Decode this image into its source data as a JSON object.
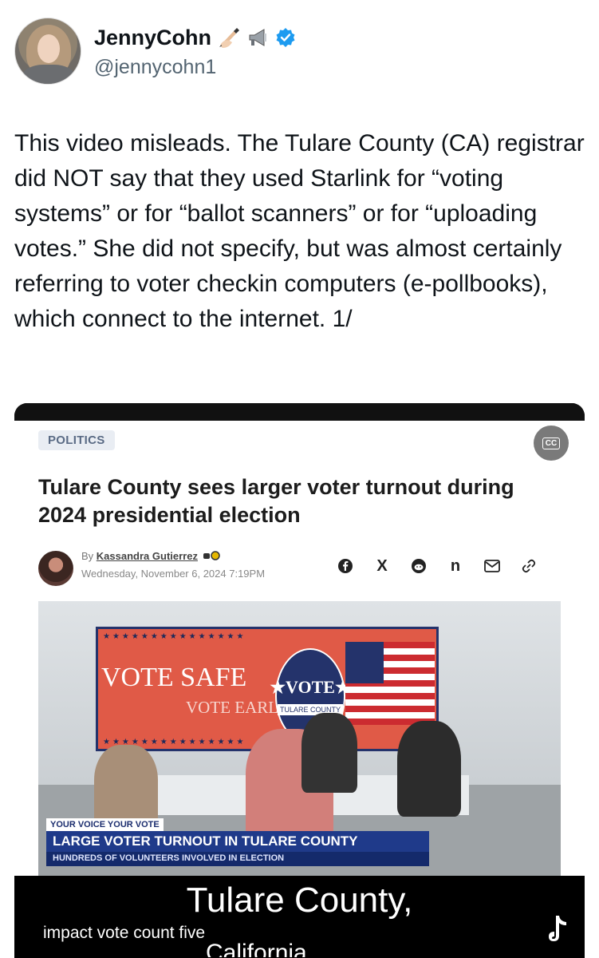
{
  "profile": {
    "display_name": "JennyCohn",
    "handle": "@jennycohn1",
    "badges": [
      "writing-hand-icon",
      "megaphone-icon",
      "verified-icon"
    ],
    "verified_color": "#1d9bf0"
  },
  "tweet": {
    "text": "This video misleads. The Tulare County (CA) registrar did NOT say that they used Starlink for “voting systems” or for “ballot scanners” or for “uploading votes.” She did not specify, but was almost certainly referring to voter checkin computers (e-pollbooks), which connect to the internet. 1/"
  },
  "media": {
    "article": {
      "category": "POLITICS",
      "cc_label": "CC",
      "headline": "Tulare County sees larger voter turnout during 2024 presidential election",
      "byline_prefix": "By",
      "author": "Kassandra Gutierrez",
      "date": "Wednesday, November 6, 2024 7:19PM",
      "share_icons": [
        "facebook-icon",
        "x-icon",
        "reddit-icon",
        "nextdoor-icon",
        "email-icon",
        "link-icon"
      ],
      "share_glyphs": {
        "x": "X",
        "nextdoor": "n"
      }
    },
    "photo": {
      "banner_stars": "★★★★★★★★★★★★★★★",
      "banner_line1": "VOTE SAFE",
      "banner_line2": "VOTE EARLY",
      "seal_vote": "★VOTE★",
      "seal_county": "TULARE COUNTY",
      "lower_third_tag": "YOUR VOICE YOUR VOTE",
      "lower_third_main": "LARGE VOTER TURNOUT IN TULARE COUNTY",
      "lower_third_sub": "HUNDREDS OF VOLUNTEERS INVOLVED IN ELECTION"
    },
    "captions": {
      "big": "Tulare County,",
      "small": "impact vote count five",
      "cut": "California"
    }
  }
}
